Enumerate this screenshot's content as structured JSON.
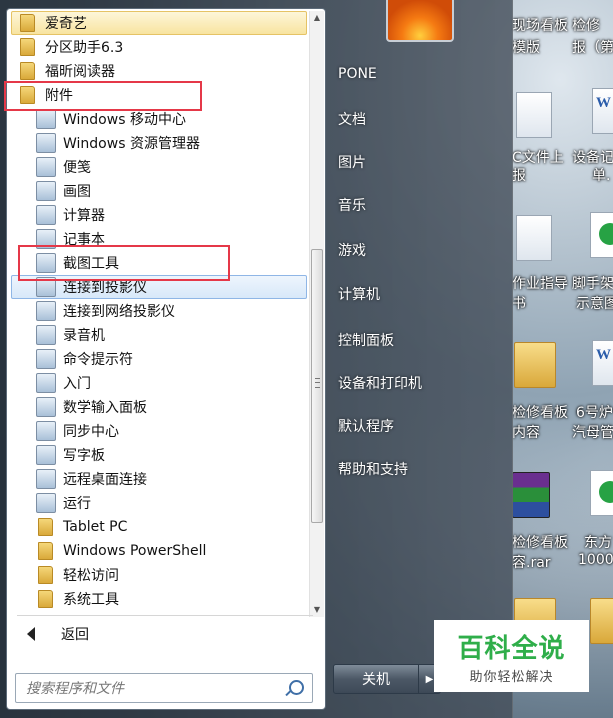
{
  "programs": [
    {
      "label": "爱奇艺",
      "icon": "folder-icon",
      "level": 0
    },
    {
      "label": "分区助手6.3",
      "icon": "folder-icon",
      "level": 0
    },
    {
      "label": "福昕阅读器",
      "icon": "folder-icon",
      "level": 0
    },
    {
      "label": "附件",
      "icon": "folder-icon",
      "level": 0
    },
    {
      "label": "Windows 移动中心",
      "icon": "mobility-center-icon",
      "level": 1
    },
    {
      "label": "Windows 资源管理器",
      "icon": "explorer-icon",
      "level": 1
    },
    {
      "label": "便笺",
      "icon": "sticky-notes-icon",
      "level": 1
    },
    {
      "label": "画图",
      "icon": "paint-icon",
      "level": 1
    },
    {
      "label": "计算器",
      "icon": "calculator-icon",
      "level": 1
    },
    {
      "label": "记事本",
      "icon": "notepad-icon",
      "level": 1
    },
    {
      "label": "截图工具",
      "icon": "snipping-tool-icon",
      "level": 1
    },
    {
      "label": "连接到投影仪",
      "icon": "projector-icon",
      "level": 1
    },
    {
      "label": "连接到网络投影仪",
      "icon": "network-projector-icon",
      "level": 1
    },
    {
      "label": "录音机",
      "icon": "microphone-icon",
      "level": 1
    },
    {
      "label": "命令提示符",
      "icon": "cmd-icon",
      "level": 1
    },
    {
      "label": "入门",
      "icon": "getting-started-icon",
      "level": 1
    },
    {
      "label": "数学输入面板",
      "icon": "math-input-icon",
      "level": 1
    },
    {
      "label": "同步中心",
      "icon": "sync-center-icon",
      "level": 1
    },
    {
      "label": "写字板",
      "icon": "wordpad-icon",
      "level": 1
    },
    {
      "label": "远程桌面连接",
      "icon": "remote-desktop-icon",
      "level": 1
    },
    {
      "label": "运行",
      "icon": "run-icon",
      "level": 1
    },
    {
      "label": "Tablet PC",
      "icon": "folder-icon",
      "level": 1
    },
    {
      "label": "Windows PowerShell",
      "icon": "folder-icon",
      "level": 1
    },
    {
      "label": "轻松访问",
      "icon": "folder-icon",
      "level": 1
    },
    {
      "label": "系统工具",
      "icon": "folder-icon",
      "level": 1
    }
  ],
  "back_label": "返回",
  "search": {
    "placeholder": "搜索程序和文件"
  },
  "right_menu": {
    "user": "PONE",
    "items": [
      "文档",
      "图片",
      "音乐",
      "游戏",
      "计算机",
      "控制面板",
      "设备和打印机",
      "默认程序",
      "帮助和支持"
    ]
  },
  "shutdown_label": "关机",
  "desktop": {
    "labels": [
      "现场看板",
      "模版",
      "检修",
      "报（第",
      "C文件上",
      "报",
      "设备记",
      "单.",
      "作业指导",
      "书",
      "脚手架",
      "示意图",
      "检修看板",
      "内容",
      "6号炉",
      "汽母管",
      "检修看板",
      "容.rar",
      "东方",
      "1000"
    ],
    "word_glyph": "W"
  },
  "watermark": {
    "title": "百科全说",
    "subtitle": "助你轻松解决"
  },
  "colors": {
    "highlight_red": "#e53848",
    "watermark_green": "#2fae4a"
  }
}
